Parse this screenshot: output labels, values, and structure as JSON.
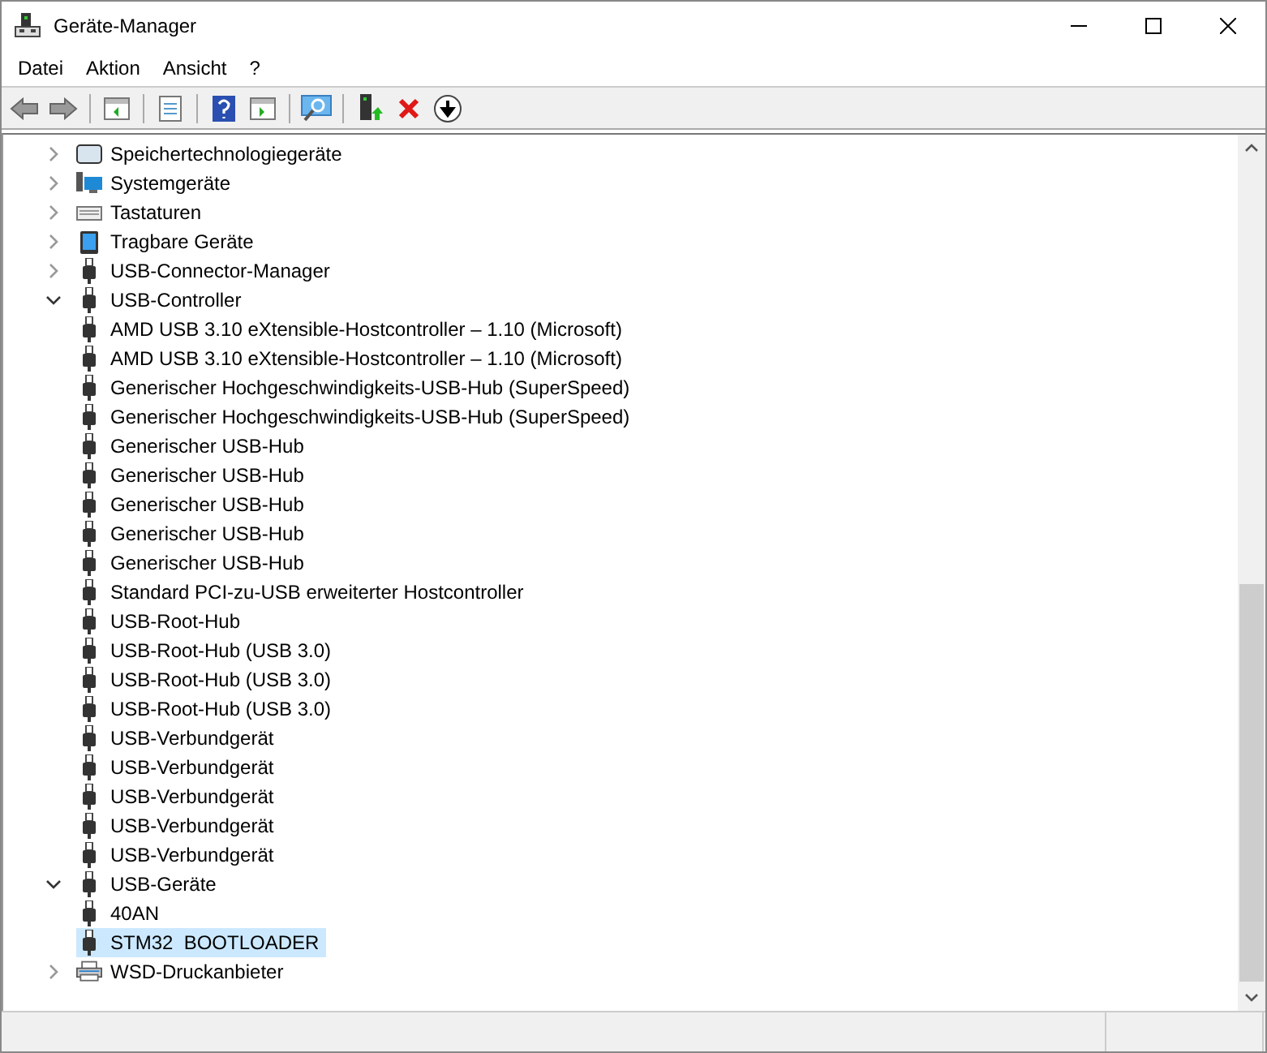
{
  "window": {
    "title": "Geräte-Manager"
  },
  "menu": [
    "Datei",
    "Aktion",
    "Ansicht",
    "?"
  ],
  "tree": [
    {
      "label": "Speichertechnologiegeräte",
      "kind": "storage",
      "expanded": false,
      "selected": false
    },
    {
      "label": "Systemgeräte",
      "kind": "system",
      "expanded": false,
      "selected": false
    },
    {
      "label": "Tastaturen",
      "kind": "keyboard",
      "expanded": false,
      "selected": false
    },
    {
      "label": "Tragbare Geräte",
      "kind": "portable",
      "expanded": false,
      "selected": false
    },
    {
      "label": "USB-Connector-Manager",
      "kind": "usb",
      "expanded": false,
      "selected": false
    },
    {
      "label": "USB-Controller",
      "kind": "usb",
      "expanded": true,
      "selected": false,
      "children": [
        {
          "label": "AMD USB 3.10 eXtensible-Hostcontroller – 1.10 (Microsoft)",
          "selected": false
        },
        {
          "label": "AMD USB 3.10 eXtensible-Hostcontroller – 1.10 (Microsoft)",
          "selected": false
        },
        {
          "label": "Generischer Hochgeschwindigkeits-USB-Hub (SuperSpeed)",
          "selected": false
        },
        {
          "label": "Generischer Hochgeschwindigkeits-USB-Hub (SuperSpeed)",
          "selected": false
        },
        {
          "label": "Generischer USB-Hub",
          "selected": false
        },
        {
          "label": "Generischer USB-Hub",
          "selected": false
        },
        {
          "label": "Generischer USB-Hub",
          "selected": false
        },
        {
          "label": "Generischer USB-Hub",
          "selected": false
        },
        {
          "label": "Generischer USB-Hub",
          "selected": false
        },
        {
          "label": "Standard PCI-zu-USB erweiterter Hostcontroller",
          "selected": false
        },
        {
          "label": "USB-Root-Hub",
          "selected": false
        },
        {
          "label": "USB-Root-Hub (USB 3.0)",
          "selected": false
        },
        {
          "label": "USB-Root-Hub (USB 3.0)",
          "selected": false
        },
        {
          "label": "USB-Root-Hub (USB 3.0)",
          "selected": false
        },
        {
          "label": "USB-Verbundgerät",
          "selected": false
        },
        {
          "label": "USB-Verbundgerät",
          "selected": false
        },
        {
          "label": "USB-Verbundgerät",
          "selected": false
        },
        {
          "label": "USB-Verbundgerät",
          "selected": false
        },
        {
          "label": "USB-Verbundgerät",
          "selected": false
        }
      ]
    },
    {
      "label": "USB-Geräte",
      "kind": "usb",
      "expanded": true,
      "selected": false,
      "children": [
        {
          "label": "40AN",
          "selected": false
        },
        {
          "label": "STM32  BOOTLOADER",
          "selected": true
        }
      ]
    },
    {
      "label": "WSD-Druckanbieter",
      "kind": "printer",
      "expanded": false,
      "selected": false
    }
  ]
}
